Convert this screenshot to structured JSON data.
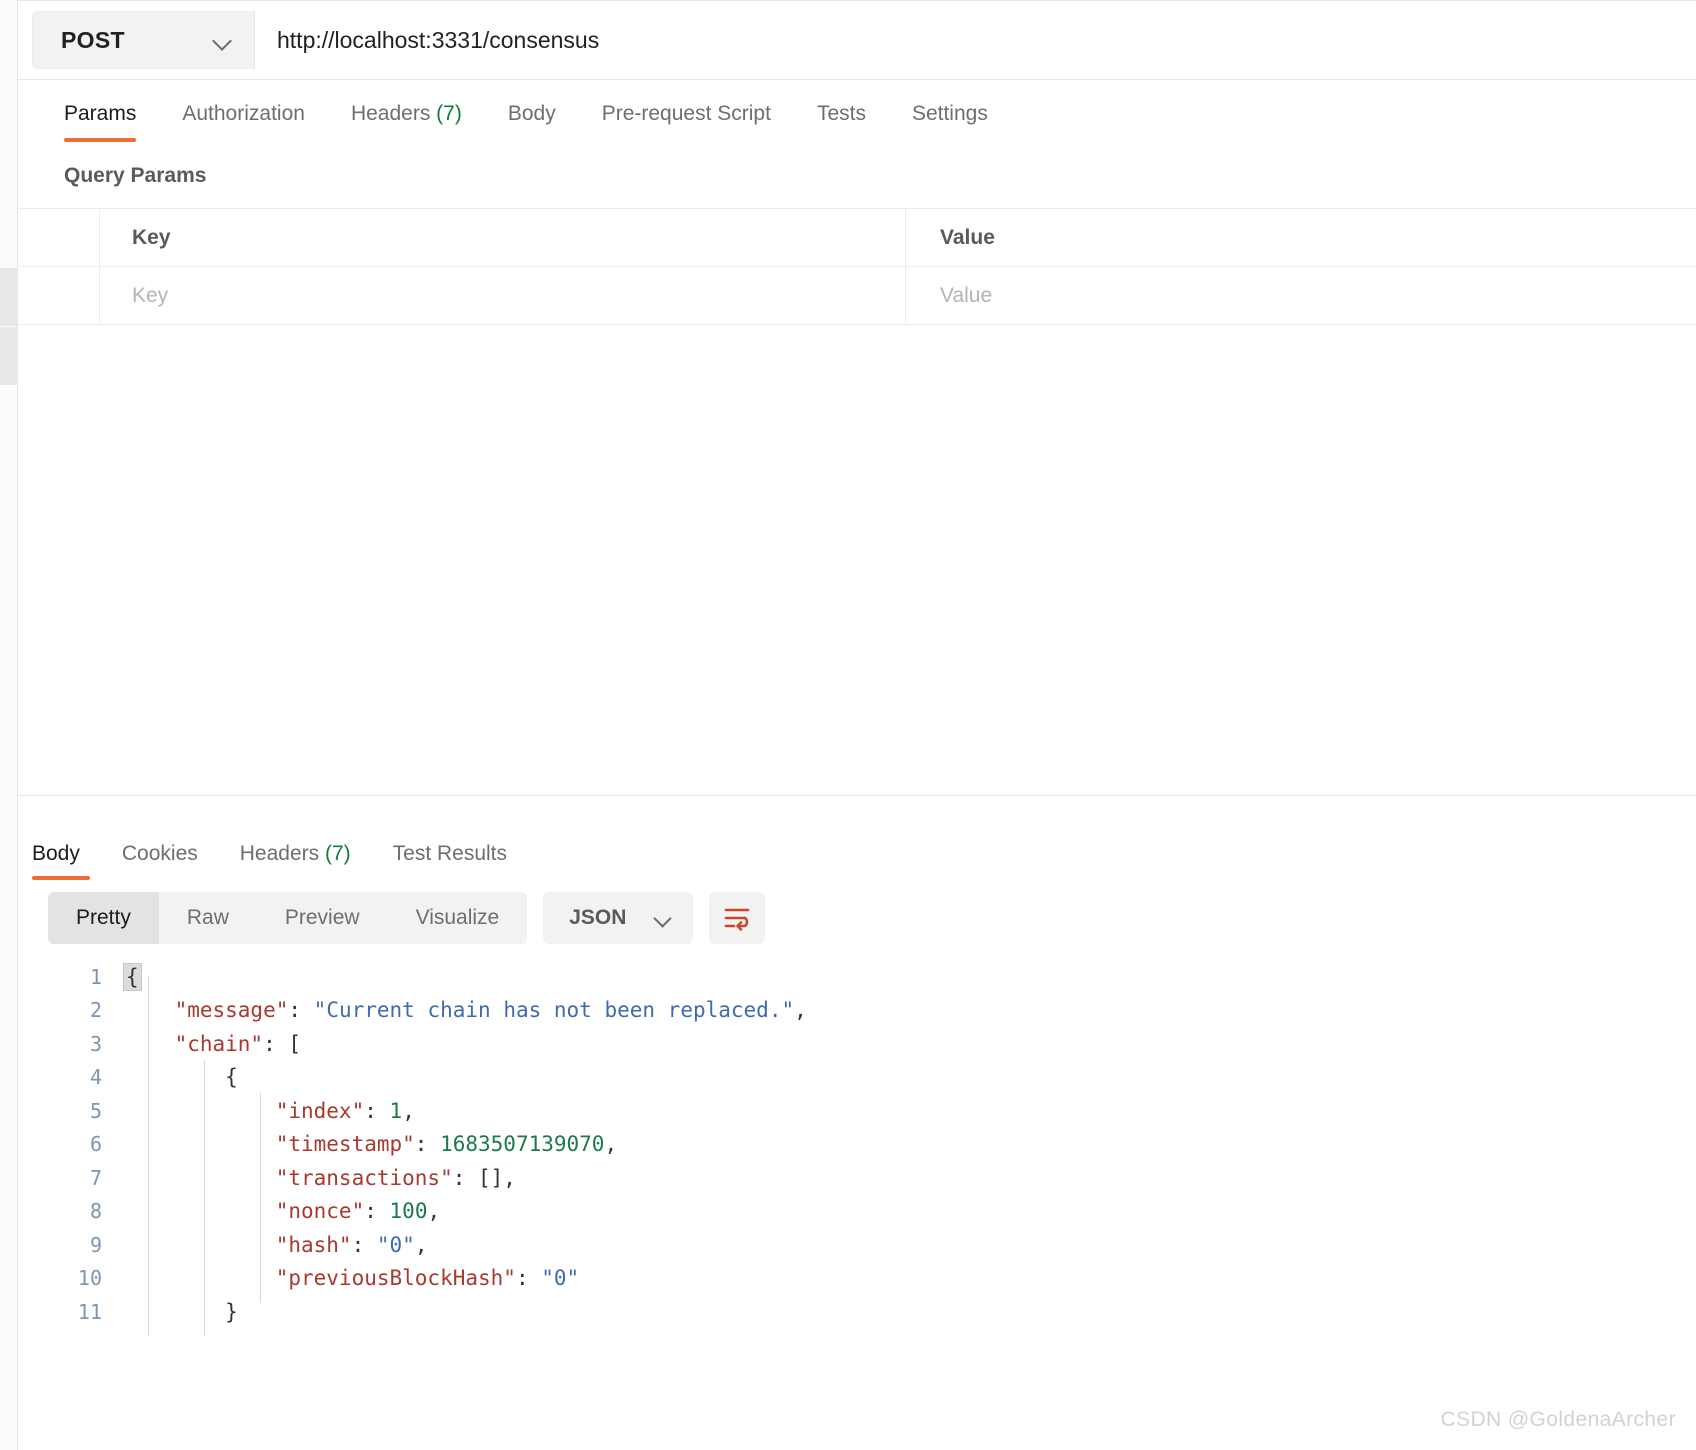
{
  "request": {
    "method": "POST",
    "url": "http://localhost:3331/consensus",
    "method_chevron_icon": "chevron-down-icon",
    "tabs": [
      {
        "label": "Params",
        "active": true,
        "count": ""
      },
      {
        "label": "Authorization",
        "active": false,
        "count": ""
      },
      {
        "label": "Headers",
        "active": false,
        "count": "(7)"
      },
      {
        "label": "Body",
        "active": false,
        "count": ""
      },
      {
        "label": "Pre-request Script",
        "active": false,
        "count": ""
      },
      {
        "label": "Tests",
        "active": false,
        "count": ""
      },
      {
        "label": "Settings",
        "active": false,
        "count": ""
      }
    ],
    "query_params": {
      "section_title": "Query Params",
      "headers": {
        "key": "Key",
        "value": "Value"
      },
      "rows": [
        {
          "key_placeholder": "Key",
          "value_placeholder": "Value"
        }
      ]
    }
  },
  "response": {
    "tabs": [
      {
        "label": "Body",
        "active": true,
        "count": ""
      },
      {
        "label": "Cookies",
        "active": false,
        "count": ""
      },
      {
        "label": "Headers",
        "active": false,
        "count": "(7)"
      },
      {
        "label": "Test Results",
        "active": false,
        "count": ""
      }
    ],
    "format_modes": [
      {
        "label": "Pretty",
        "active": true
      },
      {
        "label": "Raw",
        "active": false
      },
      {
        "label": "Preview",
        "active": false
      },
      {
        "label": "Visualize",
        "active": false
      }
    ],
    "content_type": "JSON",
    "content_type_chevron_icon": "chevron-down-icon",
    "wrap_lines_icon": "wrap-text-icon",
    "body_lines": [
      {
        "num": "1",
        "segments": [
          {
            "t": "{",
            "c": "k-punct brace-hl"
          }
        ]
      },
      {
        "num": "2",
        "segments": [
          {
            "t": "    ",
            "c": ""
          },
          {
            "t": "\"message\"",
            "c": "k-key"
          },
          {
            "t": ": ",
            "c": "k-punct"
          },
          {
            "t": "\"Current chain has not been replaced.\"",
            "c": "k-str"
          },
          {
            "t": ",",
            "c": "k-punct"
          }
        ]
      },
      {
        "num": "3",
        "segments": [
          {
            "t": "    ",
            "c": ""
          },
          {
            "t": "\"chain\"",
            "c": "k-key"
          },
          {
            "t": ": [",
            "c": "k-punct"
          }
        ]
      },
      {
        "num": "4",
        "segments": [
          {
            "t": "        {",
            "c": "k-punct"
          }
        ]
      },
      {
        "num": "5",
        "segments": [
          {
            "t": "            ",
            "c": ""
          },
          {
            "t": "\"index\"",
            "c": "k-key"
          },
          {
            "t": ": ",
            "c": "k-punct"
          },
          {
            "t": "1",
            "c": "k-num"
          },
          {
            "t": ",",
            "c": "k-punct"
          }
        ]
      },
      {
        "num": "6",
        "segments": [
          {
            "t": "            ",
            "c": ""
          },
          {
            "t": "\"timestamp\"",
            "c": "k-key"
          },
          {
            "t": ": ",
            "c": "k-punct"
          },
          {
            "t": "1683507139070",
            "c": "k-num"
          },
          {
            "t": ",",
            "c": "k-punct"
          }
        ]
      },
      {
        "num": "7",
        "segments": [
          {
            "t": "            ",
            "c": ""
          },
          {
            "t": "\"transactions\"",
            "c": "k-key"
          },
          {
            "t": ": [],",
            "c": "k-punct"
          }
        ]
      },
      {
        "num": "8",
        "segments": [
          {
            "t": "            ",
            "c": ""
          },
          {
            "t": "\"nonce\"",
            "c": "k-key"
          },
          {
            "t": ": ",
            "c": "k-punct"
          },
          {
            "t": "100",
            "c": "k-num"
          },
          {
            "t": ",",
            "c": "k-punct"
          }
        ]
      },
      {
        "num": "9",
        "segments": [
          {
            "t": "            ",
            "c": ""
          },
          {
            "t": "\"hash\"",
            "c": "k-key"
          },
          {
            "t": ": ",
            "c": "k-punct"
          },
          {
            "t": "\"0\"",
            "c": "k-str"
          },
          {
            "t": ",",
            "c": "k-punct"
          }
        ]
      },
      {
        "num": "10",
        "segments": [
          {
            "t": "            ",
            "c": ""
          },
          {
            "t": "\"previousBlockHash\"",
            "c": "k-key"
          },
          {
            "t": ": ",
            "c": "k-punct"
          },
          {
            "t": "\"0\"",
            "c": "k-str"
          }
        ]
      },
      {
        "num": "11",
        "segments": [
          {
            "t": "        }",
            "c": "k-punct"
          }
        ]
      }
    ]
  },
  "watermark": "CSDN @GoldenaArcher",
  "colors": {
    "accent": "#ef6c34",
    "count_green": "#117a3d",
    "json_key": "#a8392f",
    "json_string": "#3f6ab0",
    "json_number": "#1a7a4c",
    "line_number": "#7b96b5"
  }
}
